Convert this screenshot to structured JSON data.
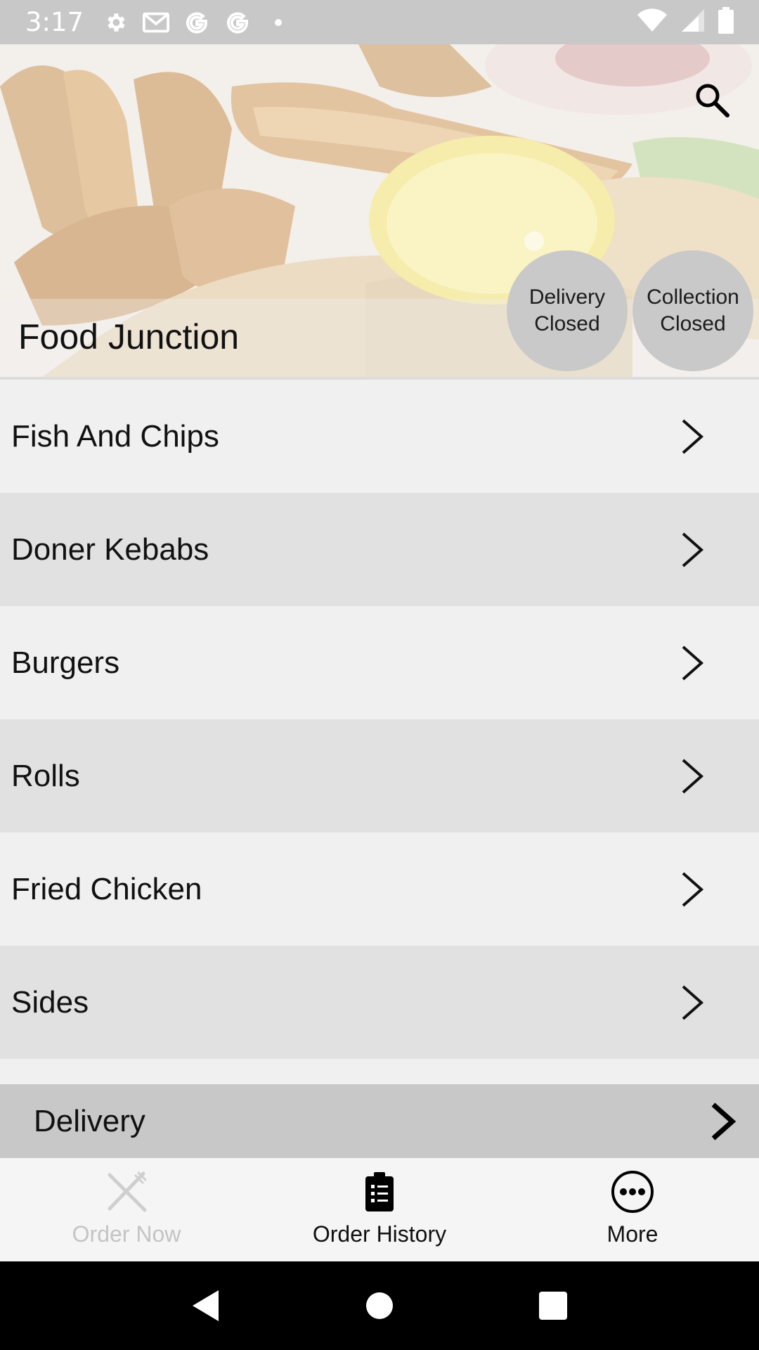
{
  "status_bar": {
    "time": "3:17",
    "left_icons": [
      "settings-icon",
      "gmail-icon",
      "google-icon",
      "google-icon",
      "dot-icon"
    ],
    "right_icons": [
      "wifi-icon",
      "signal-icon",
      "battery-icon"
    ]
  },
  "header": {
    "restaurant_name": "Food Junction",
    "search_icon": "search-icon",
    "delivery_status": {
      "line1": "Delivery",
      "line2": "Closed"
    },
    "collection_status": {
      "line1": "Collection",
      "line2": "Closed"
    }
  },
  "menu": {
    "categories": [
      {
        "label": "Fish And Chips"
      },
      {
        "label": "Doner Kebabs"
      },
      {
        "label": "Burgers"
      },
      {
        "label": "Rolls"
      },
      {
        "label": "Fried Chicken"
      },
      {
        "label": "Sides"
      }
    ]
  },
  "delivery_bar": {
    "label": "Delivery"
  },
  "bottom_nav": {
    "items": [
      {
        "label": "Order Now",
        "icon": "cutlery-icon",
        "enabled": false
      },
      {
        "label": "Order History",
        "icon": "clipboard-list-icon",
        "enabled": true
      },
      {
        "label": "More",
        "icon": "more-dots-icon",
        "enabled": true
      }
    ]
  },
  "system_nav": {
    "buttons": [
      "back-icon",
      "home-icon",
      "recents-icon"
    ]
  },
  "colors": {
    "status_bar_bg": "#c8c8c8",
    "row_light": "#f0f0f0",
    "row_dark": "#e1e1e1",
    "delivery_bar_bg": "#c8c8c8",
    "status_circle_bg": "#c9c9c9",
    "disabled_text": "#c4c4c4"
  }
}
